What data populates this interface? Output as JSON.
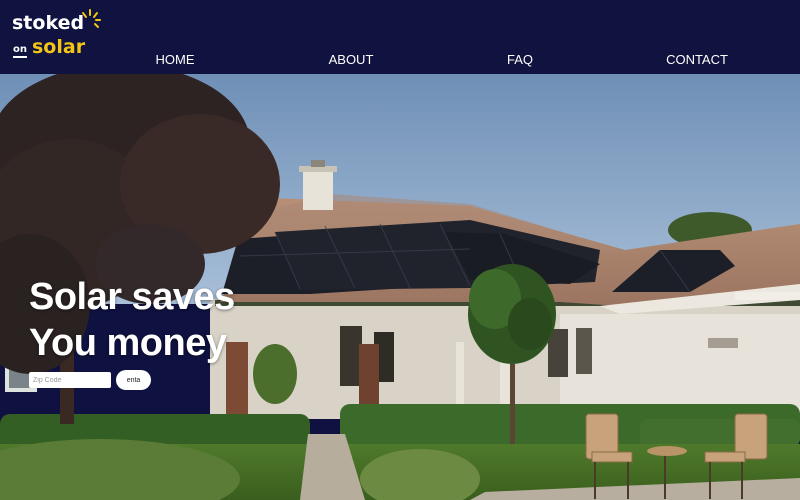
{
  "brand": {
    "logo_top": "stoked",
    "logo_on": "on",
    "logo_bottom": "solar",
    "sun_icon": "sun-icon",
    "colors": {
      "header_bg": "#10123f",
      "accent": "#f2c516",
      "text": "#ffffff"
    }
  },
  "nav": {
    "items": [
      {
        "label": "HOME"
      },
      {
        "label": "ABOUT"
      },
      {
        "label": "FAQ"
      },
      {
        "label": "CONTACT"
      }
    ]
  },
  "hero": {
    "headline_line1": "Solar saves",
    "headline_line2": "You money",
    "zip_placeholder": "Zip Code",
    "zip_value": "",
    "enter_label": "enta"
  }
}
